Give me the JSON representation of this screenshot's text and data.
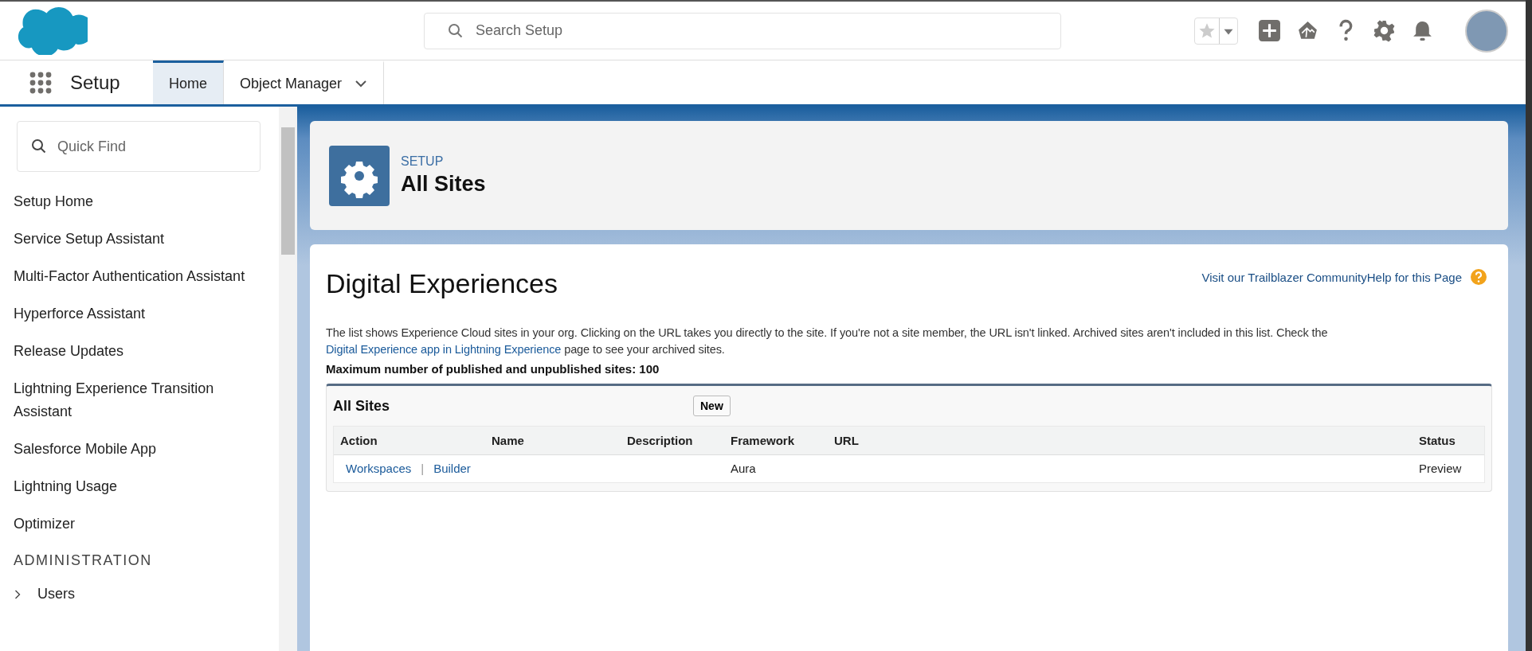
{
  "header": {
    "search": {
      "placeholder": "Search Setup"
    }
  },
  "nav": {
    "app_name": "Setup",
    "tabs": [
      {
        "label": "Home",
        "selected": true,
        "dropdown": false
      },
      {
        "label": "Object Manager",
        "selected": false,
        "dropdown": true
      }
    ]
  },
  "sidebar": {
    "quick_find": {
      "placeholder": "Quick Find"
    },
    "items": [
      {
        "label": "Setup Home"
      },
      {
        "label": "Service Setup Assistant"
      },
      {
        "label": "Multi-Factor Authentication Assistant"
      },
      {
        "label": "Hyperforce Assistant"
      },
      {
        "label": "Release Updates"
      },
      {
        "label": "Lightning Experience Transition Assistant"
      },
      {
        "label": "Salesforce Mobile App"
      },
      {
        "label": "Lightning Usage"
      },
      {
        "label": "Optimizer"
      }
    ],
    "sections": [
      {
        "title": "ADMINISTRATION",
        "items": [
          {
            "label": "Users",
            "expanded": false
          }
        ]
      }
    ]
  },
  "page_header": {
    "eyebrow": "SETUP",
    "title": "All Sites"
  },
  "main": {
    "title": "Digital Experiences",
    "help_links": [
      "Visit our Trailblazer Community",
      "Help for this Page"
    ],
    "description_parts": [
      {
        "kind": "text",
        "text": "The list shows Experience Cloud sites in your org. Clicking on the URL takes you directly to the site. If you're not a site member, the URL isn't linked. Archived sites aren't included in this list. Check the "
      },
      {
        "kind": "link",
        "text": "Digital Experience app in Lightning Experience"
      },
      {
        "kind": "text",
        "text": " page to see your archived sites."
      }
    ],
    "limit_note": "Maximum number of published and unpublished sites: 100",
    "list": {
      "title": "All Sites",
      "button": "New",
      "columns": [
        "Action",
        "Name",
        "Description",
        "Framework",
        "URL",
        "Status"
      ],
      "rows": [
        {
          "actions": [
            "Workspaces",
            "Builder"
          ],
          "separator": "|",
          "name": "",
          "description": "",
          "framework": "Aura",
          "url": "",
          "status": "Preview"
        }
      ]
    }
  }
}
